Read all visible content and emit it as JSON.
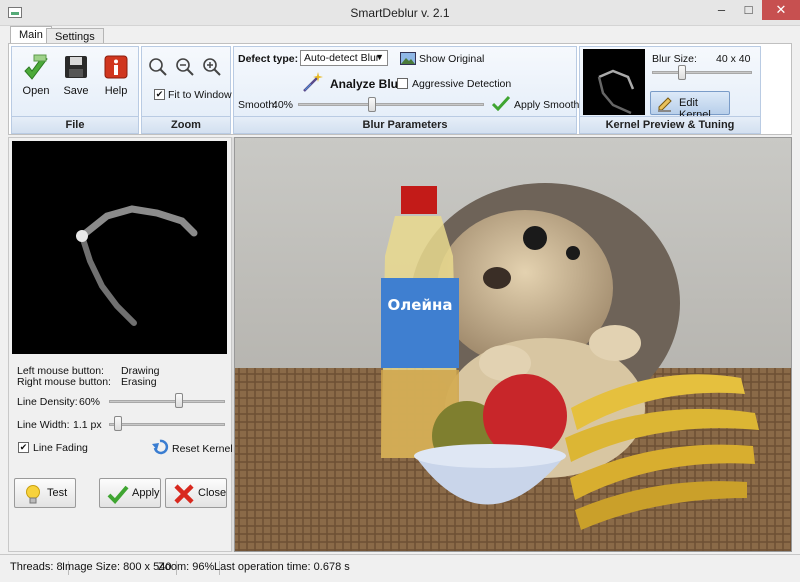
{
  "window": {
    "title": "SmartDeblur v. 2.1"
  },
  "tabs": [
    {
      "label": "Main"
    },
    {
      "label": "Settings"
    }
  ],
  "ribbon": {
    "file": {
      "title": "File",
      "open_label": "Open",
      "save_label": "Save",
      "help_label": "Help"
    },
    "zoom": {
      "title": "Zoom",
      "fit_label": "Fit to Window",
      "fit_checked": true
    },
    "blur": {
      "title": "Blur Parameters",
      "defect_label": "Defect type:",
      "defect_value": "Auto-detect Blur",
      "show_original_label": "Show Original",
      "analyze_label": "Analyze Blur",
      "aggressive_label": "Aggressive Detection",
      "smooth_label": "Smooth:",
      "smooth_value": "40%",
      "smooth_fraction": 0.4,
      "apply_smooth_label": "Apply Smooth"
    },
    "kernel": {
      "title": "Kernel Preview & Tuning",
      "blur_size_label": "Blur Size:",
      "blur_size_value": "40 x 40",
      "blur_size_fraction": 0.3,
      "edit_label": "Edit Kernel"
    }
  },
  "left": {
    "mouse_left": "Left mouse button:",
    "mouse_left_action": "Drawing",
    "mouse_right": "Right mouse button:",
    "mouse_right_action": "Erasing",
    "density_label": "Line Density:",
    "density_value": "60%",
    "density_fraction": 0.6,
    "width_label": "Line Width:",
    "width_value": "1.1 px",
    "width_fraction": 0.08,
    "fading_label": "Line Fading",
    "fading_checked": true,
    "reset_label": "Reset Kernel",
    "test_label": "Test",
    "apply_label": "Apply",
    "close_label": "Close"
  },
  "status": {
    "threads": "Threads: 8",
    "image_size": "Image Size: 800 x 540",
    "zoom": "Zoom: 96%",
    "last_op": "Last operation time: 0.678 s"
  },
  "bottle_label": "Олейна",
  "colors": {
    "accent_blue": "#b9cbe3",
    "close_red": "#c75050"
  }
}
